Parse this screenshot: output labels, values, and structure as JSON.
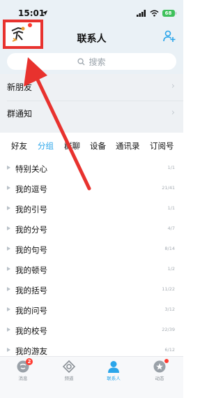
{
  "status_bar": {
    "time": "15:01",
    "battery": "68"
  },
  "header": {
    "title": "联系人",
    "add_icon": "add-friend-icon"
  },
  "search": {
    "placeholder": "搜索"
  },
  "nav_rows": [
    {
      "label": "新朋友"
    },
    {
      "label": "群通知"
    }
  ],
  "tabs": [
    {
      "label": "好友"
    },
    {
      "label": "分组",
      "active": true
    },
    {
      "label": "群聊"
    },
    {
      "label": "设备"
    },
    {
      "label": "通讯录"
    },
    {
      "label": "订阅号"
    }
  ],
  "groups": [
    {
      "name": "特别关心",
      "count": "1/1"
    },
    {
      "name": "我的逗号",
      "count": "21/41"
    },
    {
      "name": "我的引号",
      "count": "1/1"
    },
    {
      "name": "我的分号",
      "count": "4/7"
    },
    {
      "name": "我的句号",
      "count": "8/14"
    },
    {
      "name": "我的顿号",
      "count": "1/2"
    },
    {
      "name": "我的括号",
      "count": "11/22"
    },
    {
      "name": "我的问号",
      "count": "3/12"
    },
    {
      "name": "我的校号",
      "count": "22/39"
    },
    {
      "name": "我的游友",
      "count": "6/12"
    }
  ],
  "bottom_nav": [
    {
      "label": "消息",
      "icon": "message-icon",
      "badge": "2"
    },
    {
      "label": "频道",
      "icon": "channel-icon"
    },
    {
      "label": "联系人",
      "icon": "contacts-icon",
      "active": true
    },
    {
      "label": "动态",
      "icon": "moments-icon",
      "dot": true
    }
  ],
  "colors": {
    "accent": "#2aa5ea",
    "highlight_box": "#e8322e",
    "annotation_arrow": "#e8322e",
    "badge": "#ff3b30"
  }
}
